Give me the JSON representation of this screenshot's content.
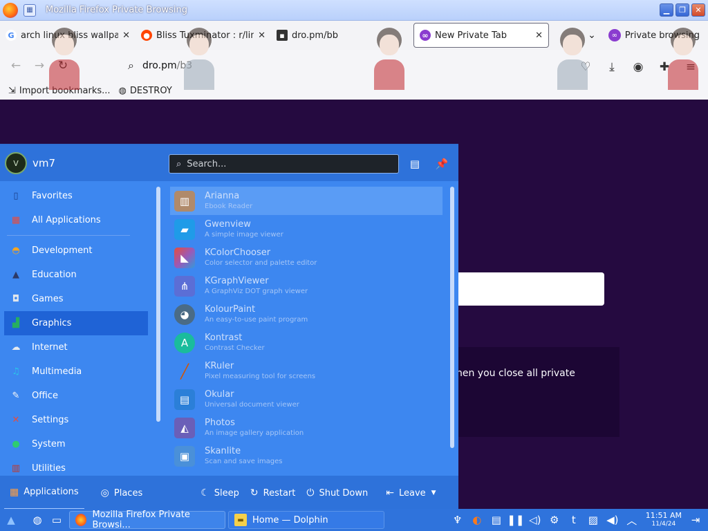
{
  "window": {
    "title": "Mozilla Firefox Private Browsing"
  },
  "tabs": [
    {
      "label": "arch linux bliss wallpa",
      "icon": "google-icon",
      "active": false
    },
    {
      "label": "Bliss Tuxminator : r/lin",
      "icon": "reddit-icon",
      "active": false
    },
    {
      "label": "dro.pm/bb",
      "icon": "page-icon",
      "active": false
    },
    {
      "label": "New Private Tab",
      "icon": "private-mask-icon",
      "active": true
    }
  ],
  "private_browsing_label": "Private browsing",
  "urlbar": {
    "host": "dro.pm",
    "path": "/b3"
  },
  "bookmarks": [
    {
      "label": "Import bookmarks...",
      "icon": "import-icon"
    },
    {
      "label": "DESTROY",
      "icon": "globe-icon"
    }
  ],
  "page": {
    "text": "hen you close all private"
  },
  "launcher": {
    "avatar_letter": "V",
    "username": "vm7",
    "search_placeholder": "Search...",
    "categories": [
      {
        "label": "Favorites",
        "icon": "bookmark-icon",
        "color": "#1f5fc9"
      },
      {
        "label": "All Applications",
        "icon": "grid-icon",
        "color": "#e94c3d"
      },
      {
        "label": "Development",
        "icon": "helmet-icon",
        "color": "#f5a623"
      },
      {
        "label": "Education",
        "icon": "graduation-cap-icon",
        "color": "#3b4a78"
      },
      {
        "label": "Games",
        "icon": "gamepad-icon",
        "color": "#d0d6dc"
      },
      {
        "label": "Graphics",
        "icon": "graphics-icon",
        "color": "#27ae60"
      },
      {
        "label": "Internet",
        "icon": "internet-icon",
        "color": "#d6dde4"
      },
      {
        "label": "Multimedia",
        "icon": "multimedia-icon",
        "color": "#2ac5e8"
      },
      {
        "label": "Office",
        "icon": "office-icon",
        "color": "#f0f0f0"
      },
      {
        "label": "Settings",
        "icon": "tools-icon",
        "color": "#e74c3c"
      },
      {
        "label": "System",
        "icon": "system-icon",
        "color": "#2ecc71"
      },
      {
        "label": "Utilities",
        "icon": "utilities-icon",
        "color": "#c0392b"
      }
    ],
    "selected_category": "Graphics",
    "apps": [
      {
        "name": "Arianna",
        "desc": "Ebook Reader",
        "icon": "book-icon",
        "color": "#b08a6a"
      },
      {
        "name": "Gwenview",
        "desc": "A simple image viewer",
        "icon": "image-viewer-icon",
        "color": "#1f9be8"
      },
      {
        "name": "KColorChooser",
        "desc": "Color selector and palette editor",
        "icon": "color-chooser-icon",
        "color": "#7b52c9"
      },
      {
        "name": "KGraphViewer",
        "desc": "A GraphViz DOT graph viewer",
        "icon": "graph-icon",
        "color": "#5b6ed6"
      },
      {
        "name": "KolourPaint",
        "desc": "An easy-to-use paint program",
        "icon": "palette-icon",
        "color": "#4a6b86"
      },
      {
        "name": "Kontrast",
        "desc": "Contrast Checker",
        "icon": "contrast-icon",
        "color": "#1abc9c"
      },
      {
        "name": "KRuler",
        "desc": "Pixel measuring tool for screens",
        "icon": "ruler-icon",
        "color": "#d35400"
      },
      {
        "name": "Okular",
        "desc": "Universal document viewer",
        "icon": "document-viewer-icon",
        "color": "#2b7fd8"
      },
      {
        "name": "Photos",
        "desc": "An image gallery application",
        "icon": "photos-icon",
        "color": "#6a5fb8"
      },
      {
        "name": "Skanlite",
        "desc": "Scan and save images",
        "icon": "scanner-icon",
        "color": "#4a90d9"
      }
    ],
    "footer": {
      "applications": "Applications",
      "places": "Places",
      "sleep": "Sleep",
      "restart": "Restart",
      "shutdown": "Shut Down",
      "leave": "Leave"
    }
  },
  "taskbar": {
    "tasks": [
      {
        "label": "Mozilla Firefox Private Browsi...",
        "icon": "firefox-icon"
      },
      {
        "label": "Home — Dolphin",
        "icon": "folder-icon"
      }
    ],
    "clock": {
      "time": "11:51 AM",
      "date": "11/4/24"
    }
  }
}
